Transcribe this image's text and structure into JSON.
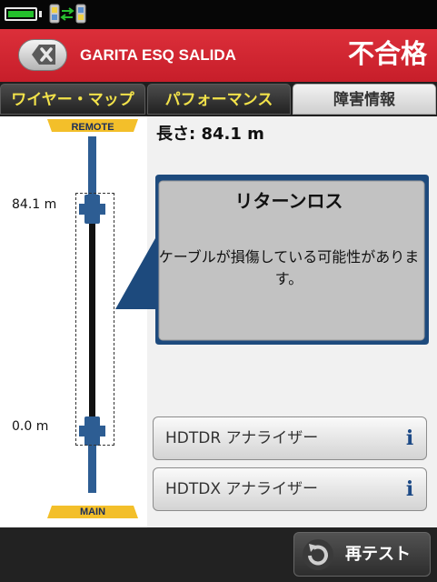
{
  "status_bar": {
    "battery_icon": "battery-full-icon",
    "battery_color": "#24c02c",
    "link_icon": "device-link-icon"
  },
  "header": {
    "back_icon": "close-x-icon",
    "title": "GARITA ESQ SALIDA",
    "result": "不合格",
    "background_color": "#d52a35"
  },
  "tabs": [
    {
      "label": "ワイヤー・マップ",
      "active": false
    },
    {
      "label": "パフォーマンス",
      "active": false
    },
    {
      "label": "障害情報",
      "active": true
    }
  ],
  "diagram": {
    "remote_label": "REMOTE",
    "main_label": "MAIN",
    "far_distance": "84.1 m",
    "near_distance": "0.0 m",
    "cable_color": "#2d5d93",
    "plug_color": "#f3bf2a"
  },
  "length": {
    "label": "長さ:",
    "value": "84.1 m"
  },
  "callout": {
    "title": "リターンロス",
    "message": "ケーブルが損傷している可能性があります。"
  },
  "analyzers": [
    {
      "label": "HDTDR アナライザー",
      "icon": "info-icon",
      "icon_glyph": "i"
    },
    {
      "label": "HDTDX アナライザー",
      "icon": "info-icon",
      "icon_glyph": "i"
    }
  ],
  "footer": {
    "retest_label": "再テスト",
    "retest_icon": "retest-icon"
  }
}
